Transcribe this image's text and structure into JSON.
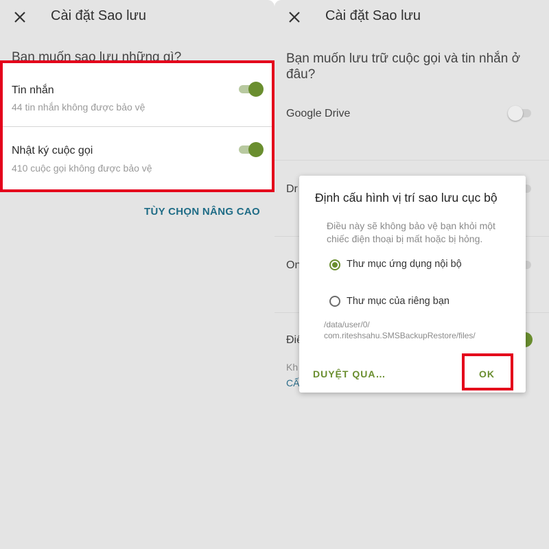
{
  "left": {
    "title": "Cài đặt Sao lưu",
    "heading": "Bạn muốn sao lưu những gì?",
    "items": [
      {
        "title": "Tin nhắn",
        "subtitle": "44 tin nhắn không được bảo vệ",
        "toggle": "on"
      },
      {
        "title": "Nhật ký cuộc gọi",
        "subtitle": "410 cuộc gọi không được bảo vệ",
        "toggle": "on"
      }
    ],
    "advanced_label": "TÙY CHỌN NÂNG CAO"
  },
  "right": {
    "title": "Cài đặt Sao lưu",
    "heading_line1": "Bạn muốn lưu trữ cuộc gọi và tin nhắn ở",
    "heading_line2": "đâu?",
    "items": [
      {
        "label": "Google Drive",
        "toggle": "off"
      },
      {
        "label": "Dr",
        "toggle": "off"
      },
      {
        "label": "On",
        "toggle": "off"
      },
      {
        "label": "Điệ",
        "toggle": "on"
      }
    ],
    "partial_line1": "Kh",
    "partial_line2": "CẤ"
  },
  "dialog": {
    "title": "Định cấu hình vị trí sao lưu cục bộ",
    "message": "Điều này sẽ không bảo vệ bạn khỏi một chiếc điện thoại bị mất hoặc bị hỏng.",
    "options": [
      {
        "label": "Thư mục ứng dụng nội bộ",
        "selected": true
      },
      {
        "label": "Thư mục của riêng bạn",
        "selected": false
      }
    ],
    "path_line1": "/data/user/0/",
    "path_line2": "com.riteshsahu.SMSBackupRestore/files/",
    "browse_label": "DUYỆT QUA…",
    "ok_label": "OK"
  },
  "colors": {
    "accent_green": "#6a8e2f",
    "link_blue": "#1f6c86",
    "highlight_red": "#e4001b",
    "dim_background": "#e4e4e4"
  }
}
